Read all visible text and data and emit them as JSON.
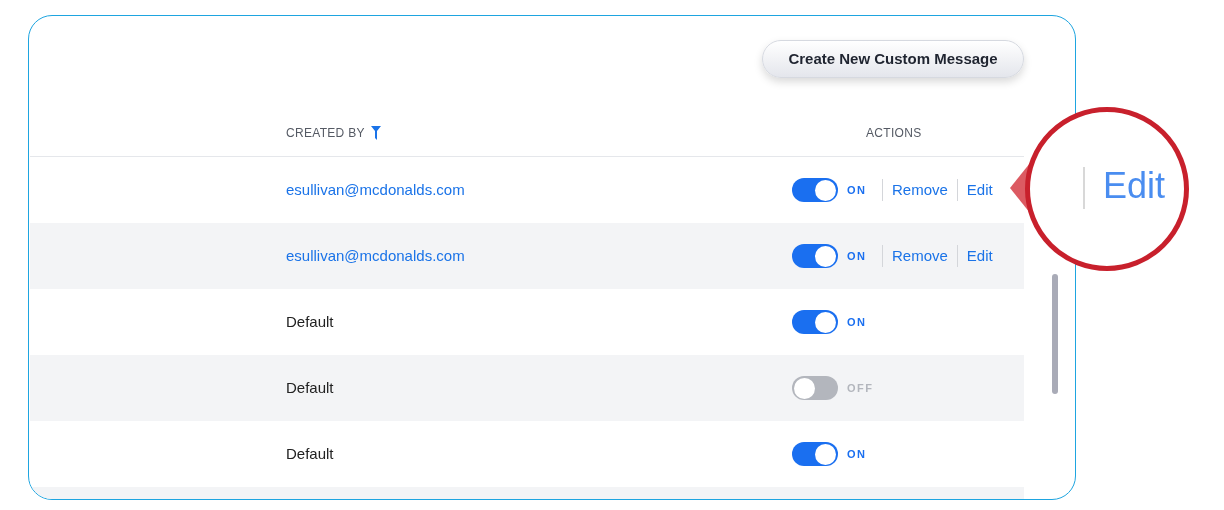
{
  "create_button": "Create New Custom Message",
  "columns": [
    {
      "label": "CREATED BY",
      "filter": true
    },
    {
      "label": "ACTIONS",
      "filter": false
    }
  ],
  "rows": [
    {
      "created_by": "esullivan@mcdonalds.com",
      "kind": "email",
      "on": true,
      "state_label": "ON",
      "actions": [
        "Remove",
        "Edit"
      ]
    },
    {
      "created_by": "esullivan@mcdonalds.com",
      "kind": "email",
      "on": true,
      "state_label": "ON",
      "actions": [
        "Remove",
        "Edit"
      ]
    },
    {
      "created_by": "Default",
      "kind": "default",
      "on": true,
      "state_label": "ON"
    },
    {
      "created_by": "Default",
      "kind": "default",
      "on": false,
      "state_label": "OFF"
    },
    {
      "created_by": "Default",
      "kind": "default",
      "on": true,
      "state_label": "ON"
    }
  ],
  "callout": {
    "label": "Edit"
  }
}
